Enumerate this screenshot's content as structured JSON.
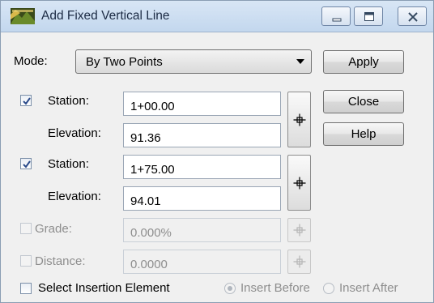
{
  "window": {
    "title": "Add Fixed Vertical Line",
    "controls": [
      "minimize-icon",
      "maximize-icon",
      "close-icon"
    ]
  },
  "mode": {
    "label": "Mode:",
    "selected": "By Two Points"
  },
  "buttons": {
    "apply": "Apply",
    "close": "Close",
    "help": "Help"
  },
  "point1": {
    "checked": true,
    "station_label": "Station:",
    "station_value": "1+00.00",
    "elevation_label": "Elevation:",
    "elevation_value": "91.36"
  },
  "point2": {
    "checked": true,
    "station_label": "Station:",
    "station_value": "1+75.00",
    "elevation_label": "Elevation:",
    "elevation_value": "94.01"
  },
  "grade": {
    "checked": false,
    "enabled": false,
    "label": "Grade:",
    "value": "0.000%"
  },
  "distance": {
    "checked": false,
    "enabled": false,
    "label": "Distance:",
    "value": "0.0000"
  },
  "insertion": {
    "checked": false,
    "select_label": "Select Insertion Element",
    "insert_before": "Insert Before",
    "insert_after": "Insert After",
    "selected": "insert_before"
  },
  "colors": {
    "title_bar": "#c3d7ee",
    "dialog_bg": "#f0f0f0",
    "disabled_text": "#8e8e8e"
  }
}
